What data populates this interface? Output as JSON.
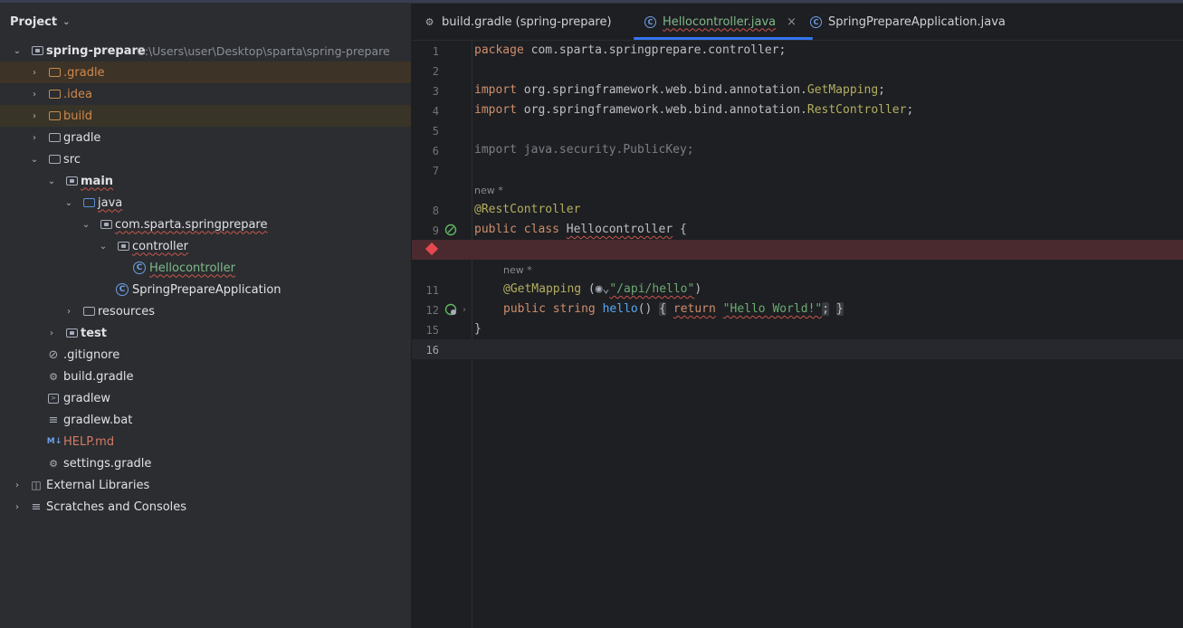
{
  "project_panel": {
    "title": "Project",
    "tree": [
      {
        "label": "spring-prepare",
        "path": "C:\\Users\\user\\Desktop\\sparta\\spring-prepare",
        "depth": 0,
        "expanded": true
      },
      {
        "label": ".gradle",
        "depth": 1
      },
      {
        "label": ".idea",
        "depth": 1
      },
      {
        "label": "build",
        "depth": 1
      },
      {
        "label": "gradle",
        "depth": 1
      },
      {
        "label": "src",
        "depth": 1
      },
      {
        "label": "main",
        "depth": 2
      },
      {
        "label": "java",
        "depth": 3
      },
      {
        "label": "com.sparta.springprepare",
        "depth": 4
      },
      {
        "label": "controller",
        "depth": 5
      },
      {
        "label": "Hellocontroller",
        "depth": 6
      },
      {
        "label": "SpringPrepareApplication",
        "depth": 5
      },
      {
        "label": "resources",
        "depth": 3
      },
      {
        "label": "test",
        "depth": 2
      },
      {
        "label": ".gitignore",
        "depth": 1
      },
      {
        "label": "build.gradle",
        "depth": 1
      },
      {
        "label": "gradlew",
        "depth": 1
      },
      {
        "label": "gradlew.bat",
        "depth": 1
      },
      {
        "label": "HELP.md",
        "depth": 1
      },
      {
        "label": "settings.gradle",
        "depth": 1
      },
      {
        "label": "External Libraries",
        "depth": 0
      },
      {
        "label": "Scratches and Consoles",
        "depth": 0
      }
    ]
  },
  "tabs": [
    {
      "label": "build.gradle (spring-prepare)",
      "icon": "gradle-icon"
    },
    {
      "label": "Hellocontroller.java",
      "icon": "class-icon",
      "active": true,
      "close": "×"
    },
    {
      "label": "SpringPrepareApplication.java",
      "icon": "class-icon"
    }
  ],
  "editor": {
    "line_numbers": [
      "1",
      "2",
      "3",
      "4",
      "5",
      "6",
      "7",
      "8",
      "9",
      "11",
      "12",
      "15",
      "16"
    ],
    "hint_new": "new *",
    "lines": {
      "l1_kw": "package",
      "l1_rest": " com.sparta.springprepare.controller;",
      "l3_kw": "import",
      "l3_pkg": " org.springframework.web.bind.annotation.",
      "l3_cls": "GetMapping",
      "l3_end": ";",
      "l4_kw": "import",
      "l4_pkg": " org.springframework.web.bind.annotation.",
      "l4_cls": "RestController",
      "l4_end": ";",
      "l6": "import java.security.PublicKey;",
      "l8": "@RestController",
      "l9_kw1": "public",
      "l9_kw2": "class",
      "l9_name": "Hellocontroller",
      "l9_brace": " {",
      "l11_ann": "@GetMapping",
      "l11_open": " (",
      "l11_str": "\"/api/hello\"",
      "l11_close": ")",
      "l12_kw": "public",
      "l12_type": "string",
      "l12_fn": "hello",
      "l12_paren": "()",
      "l12_open": "{",
      "l12_ret": "return",
      "l12_str": "\"Hello World!\"",
      "l12_semi": ";",
      "l12_close": "}",
      "l15": "}"
    }
  },
  "colors": {
    "accent": "#3574f0",
    "error_line": "#4a2a2f",
    "breakpoint": "#e5484d"
  }
}
